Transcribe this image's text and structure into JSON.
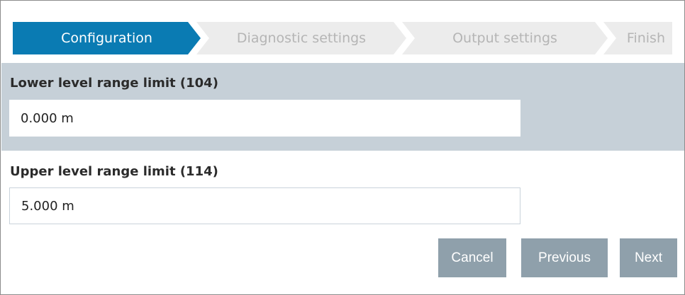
{
  "wizard": {
    "steps": [
      {
        "label": "Configuration",
        "state": "active"
      },
      {
        "label": "Diagnostic settings",
        "state": "inactive"
      },
      {
        "label": "Output settings",
        "state": "inactive"
      },
      {
        "label": "Finish",
        "state": "inactive"
      }
    ]
  },
  "fields": {
    "lower": {
      "label": "Lower level range limit (104)",
      "value": "0.000 m"
    },
    "upper": {
      "label": "Upper level range limit (114)",
      "value": "5.000 m"
    }
  },
  "buttons": {
    "cancel": "Cancel",
    "previous": "Previous",
    "next": "Next"
  },
  "colors": {
    "active_step": "#0a7bb3",
    "inactive_step": "#ececec",
    "highlight_section": "#c6d0d8",
    "button": "#8fa0ab"
  }
}
